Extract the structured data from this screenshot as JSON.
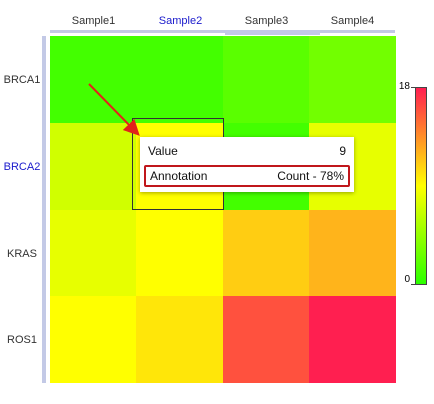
{
  "chart_data": {
    "type": "heatmap",
    "columns": [
      "Sample1",
      "Sample2",
      "Sample3",
      "Sample4"
    ],
    "rows": [
      "BRCA1",
      "BRCA2",
      "KRAS",
      "ROS1"
    ],
    "selected_column": "Sample2",
    "selected_row": "BRCA2",
    "values": [
      [
        1,
        1,
        2,
        3
      ],
      [
        7,
        9,
        1,
        8
      ],
      [
        8,
        9,
        11,
        12
      ],
      [
        9,
        10,
        16,
        18
      ]
    ],
    "legend": {
      "min": 0,
      "max": 18,
      "min_label": "0",
      "max_label": "18",
      "colors": [
        "#2bff00",
        "#ffff00",
        "#ff1f50"
      ]
    }
  },
  "tooltip": {
    "value_label": "Value",
    "value": "9",
    "annotation_label": "Annotation",
    "annotation_value": "Count - 78%"
  },
  "colors": {
    "accent": "#1a1acc",
    "highlight_border": "#c0161b",
    "arrow": "#e2231a",
    "dendrogram": "#c3c9e6"
  }
}
